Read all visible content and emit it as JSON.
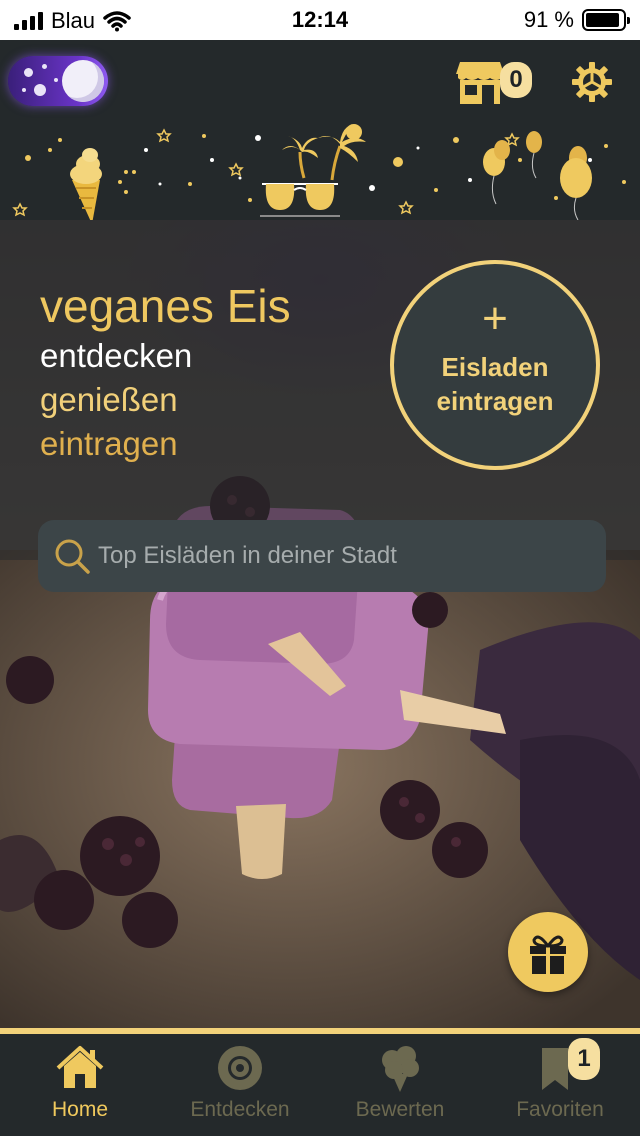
{
  "status_bar": {
    "carrier": "Blau",
    "time": "12:14",
    "battery": "91 %",
    "battery_level": 0.91
  },
  "header": {
    "theme_toggle": "night-mode",
    "shop_badge": "0",
    "icons": [
      "store-icon",
      "gear-icon",
      "ice-cream-cone-icon",
      "palm-trees-icon",
      "sunglasses-icon",
      "balloons-icon"
    ]
  },
  "hero": {
    "tagline": [
      "veganes Eis",
      "entdecken",
      "genießen",
      "eintragen"
    ],
    "add_shop_plus": "+",
    "add_shop_label": "Eisladen\neintragen",
    "search_placeholder": "Top Eisläden in deiner Stadt"
  },
  "tabs": [
    {
      "label": "Home",
      "icon": "home-icon",
      "active": true
    },
    {
      "label": "Entdecken",
      "icon": "target-icon",
      "active": false
    },
    {
      "label": "Bewerten",
      "icon": "ice-cream-icon",
      "active": false
    },
    {
      "label": "Favoriten",
      "icon": "bookmark-icon",
      "active": false
    }
  ],
  "favorites_badge": "1",
  "colors": {
    "accent": "#f0c95d",
    "background": "#24292b",
    "inactive": "#6c6950",
    "toggle": "#6a34c8"
  }
}
